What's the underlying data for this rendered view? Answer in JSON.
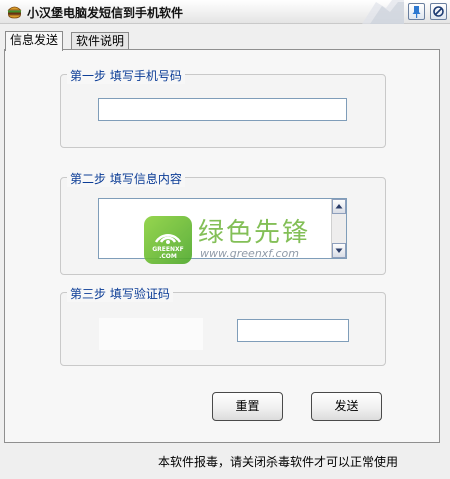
{
  "window": {
    "title": "小汉堡电脑发短信到手机软件"
  },
  "tabs": [
    {
      "label": "信息发送",
      "active": true
    },
    {
      "label": "软件说明",
      "active": false
    }
  ],
  "steps": {
    "step1": {
      "legend": "第一步 填写手机号码",
      "value": ""
    },
    "step2": {
      "legend": "第二步 填写信息内容",
      "value": ""
    },
    "step3": {
      "legend": "第三步 填写验证码",
      "value": ""
    }
  },
  "buttons": {
    "reset": "重置",
    "send": "发送"
  },
  "status": {
    "text": "本软件报毒，请关闭杀毒软件才可以正常使用"
  },
  "watermark": {
    "brand_cn": "绿色先锋",
    "logo_text_1": "GREENXF",
    "logo_text_2": ".COM",
    "url": "www.greenxf.com"
  },
  "colors": {
    "legend": "#0b3c96",
    "watermark_green": "#6eb43a"
  },
  "icons": {
    "app": "hamburger-icon",
    "pin": "pin-icon",
    "close": "close-icon",
    "scroll_up": "arrow-up-icon",
    "scroll_down": "arrow-down-icon"
  }
}
